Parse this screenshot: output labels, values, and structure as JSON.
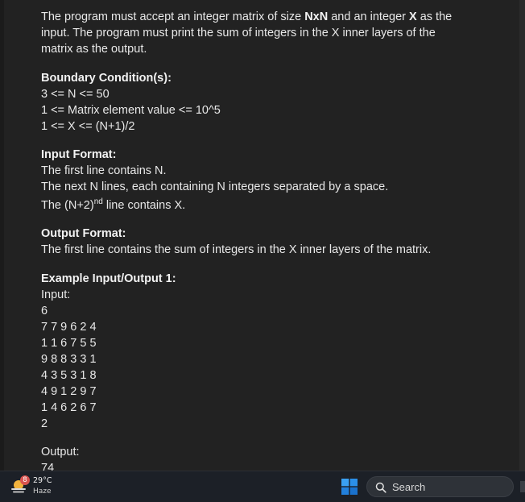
{
  "problem": {
    "intro_line1_a": "The program must accept an integer matrix of size ",
    "intro_line1_b": "NxN",
    "intro_line1_c": " and an integer ",
    "intro_line1_d": "X",
    "intro_line1_e": " as the",
    "intro_line2": "input. The program must print the sum of integers in the X inner layers of the",
    "intro_line3": "matrix as the output.",
    "boundary_heading": "Boundary Condition(s):",
    "boundary_lines": [
      "3 <= N <= 50",
      "1 <= Matrix element value <= 10^5",
      "1 <= X <= (N+1)/2"
    ],
    "input_heading": "Input Format:",
    "input_line1": "The first line contains N.",
    "input_line2": "The next N lines, each containing N integers separated by a space.",
    "input_line3_a": "The (N+2)",
    "input_line3_sup": "nd",
    "input_line3_b": " line contains X.",
    "output_heading": "Output Format:",
    "output_line1": "The first line contains the sum of integers in the X inner layers of the matrix.",
    "example_heading": "Example Input/Output 1:",
    "input_label": "Input:",
    "example_input": [
      "6",
      "7 7 9 6 2 4",
      "1 1 6 7 5 5",
      "9 8 8 3 3 1",
      "4 3 5 3 1 8",
      "4 9 1 2 9 7",
      "1 4 6 2 6 7",
      "2"
    ],
    "output_label": "Output:",
    "example_output": "74"
  },
  "taskbar": {
    "weather_badge": "8",
    "weather_temp": "29°C",
    "weather_cond": "Haze",
    "search_label": "Search",
    "start_colors": [
      "#3aa0f2",
      "#2b86e0",
      "#1f73d1",
      "#1866c0"
    ]
  }
}
